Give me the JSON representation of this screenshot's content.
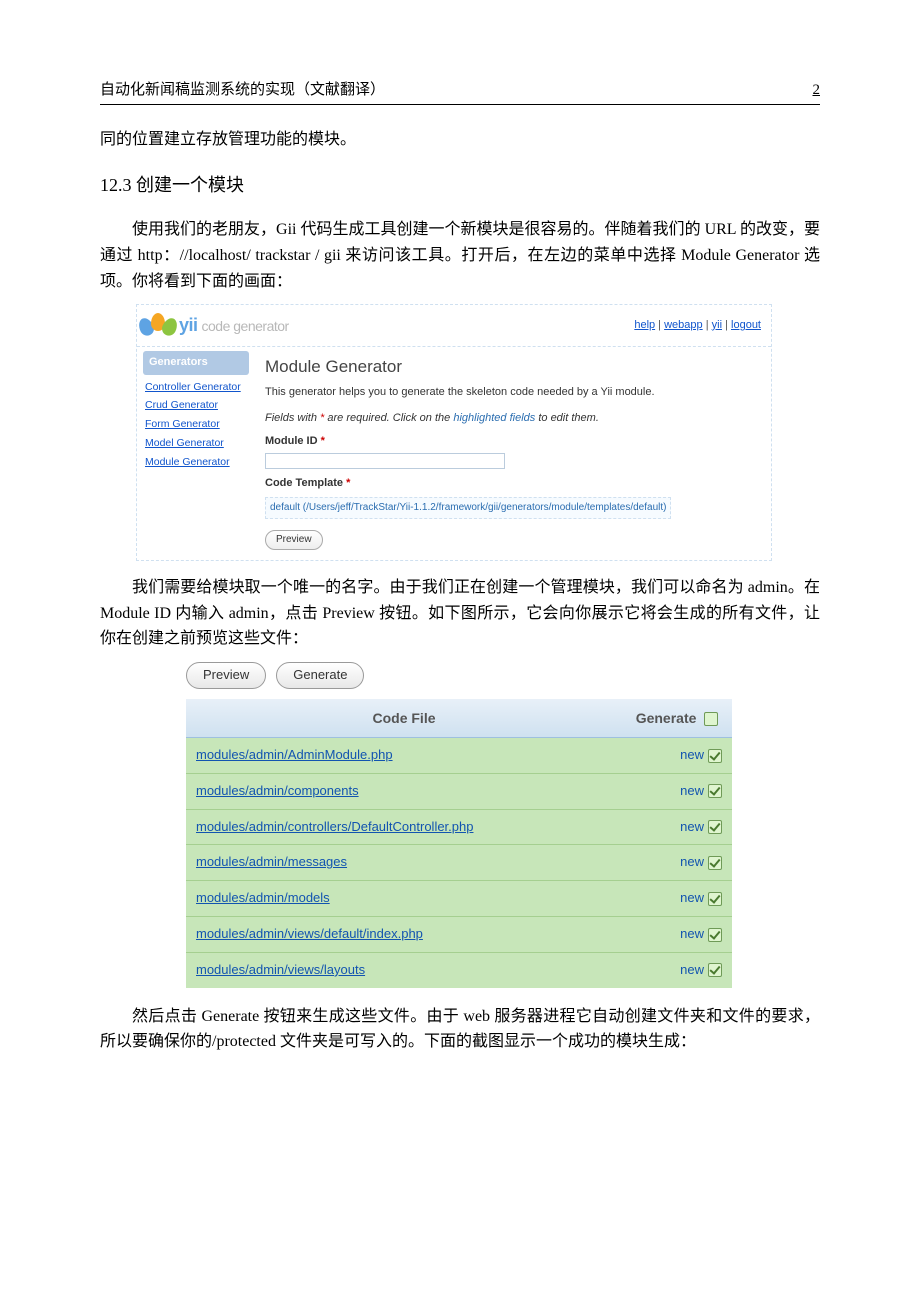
{
  "header": {
    "title": "自动化新闻稿监测系统的实现（文献翻译）",
    "page": "2"
  },
  "p1": "同的位置建立存放管理功能的模块。",
  "h3": {
    "num": "12.3",
    "text": "创建一个模块"
  },
  "p2": "使用我们的老朋友，Gii 代码生成工具创建一个新模块是很容易的。伴随着我们的 URL 的改变，要通过 http：//localhost/ trackstar / gii 来访问该工具。打开后，在左边的菜单中选择 Module Generator 选项。你将看到下面的画面：",
  "gii": {
    "brand_y": "yii",
    "brand_cg": "code generator",
    "links": {
      "help": "help",
      "webapp": "webapp",
      "yii": "yii",
      "logout": "logout",
      "sep": " | "
    },
    "side_title": "Generators",
    "side_items": [
      "Controller Generator",
      "Crud Generator",
      "Form Generator",
      "Model Generator",
      "Module Generator"
    ],
    "title": "Module Generator",
    "desc": "This generator helps you to generate the skeleton code needed by a Yii module.",
    "hint_pre": "Fields with ",
    "hint_star": "*",
    "hint_mid": " are required. Click on the ",
    "hint_hl": "highlighted fields",
    "hint_post": " to edit them.",
    "module_id_label": "Module ID ",
    "code_template_label": "Code Template ",
    "default_path": "default (/Users/jeff/TrackStar/Yii-1.1.2/framework/gii/generators/module/templates/default)",
    "preview_btn": "Preview"
  },
  "p3": "我们需要给模块取一个唯一的名字。由于我们正在创建一个管理模块，我们可以命名为 admin。在 Module ID 内输入 admin，点击 Preview 按钮。如下图所示，它会向你展示它将会生成的所有文件，让你在创建之前预览这些文件：",
  "pg": {
    "preview_btn": "Preview",
    "generate_btn": "Generate",
    "col_code": "Code File",
    "col_gen": "Generate",
    "new_label": "new",
    "files": [
      "modules/admin/AdminModule.php",
      "modules/admin/components",
      "modules/admin/controllers/DefaultController.php",
      "modules/admin/messages",
      "modules/admin/models",
      "modules/admin/views/default/index.php",
      "modules/admin/views/layouts"
    ]
  },
  "p4": "然后点击 Generate 按钮来生成这些文件。由于 web 服务器进程它自动创建文件夹和文件的要求，所以要确保你的/protected 文件夹是可写入的。下面的截图显示一个成功的模块生成："
}
